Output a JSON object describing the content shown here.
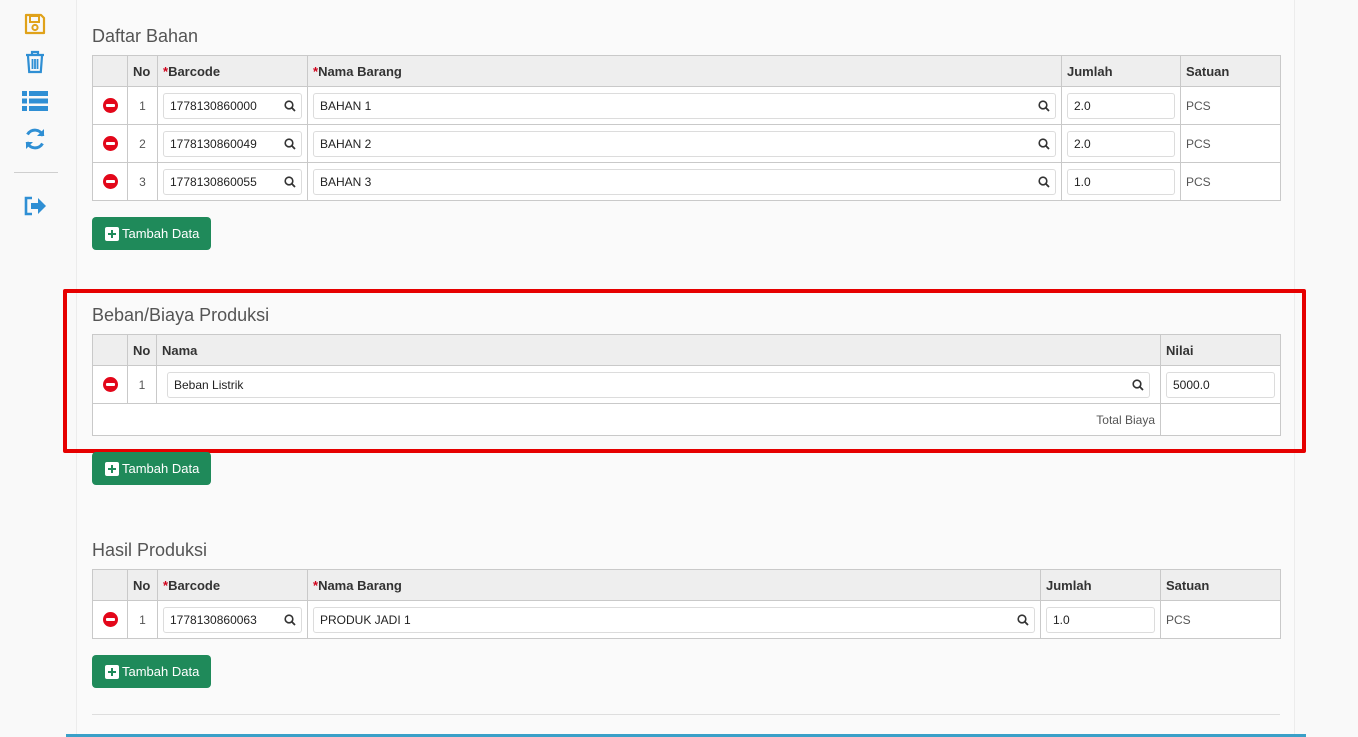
{
  "colors": {
    "accent_green": "#1f8a5a",
    "remove_red": "#e3071a",
    "highlight_red": "#e60000",
    "required_red": "#d0021b"
  },
  "sidebar": {
    "items": [
      {
        "name": "save-icon"
      },
      {
        "name": "trash-icon"
      },
      {
        "name": "list-icon"
      },
      {
        "name": "refresh-icon"
      },
      {
        "name": "logout-icon"
      }
    ]
  },
  "bahan": {
    "title": "Daftar Bahan",
    "headers": {
      "no": "No",
      "barcode_req": "*",
      "barcode": "Barcode",
      "nama_req": "*",
      "nama": "Nama Barang",
      "jumlah": "Jumlah",
      "satuan": "Satuan"
    },
    "rows": [
      {
        "no": "1",
        "barcode": "1778130860000",
        "nama": "BAHAN 1",
        "jumlah": "2.0",
        "satuan": "PCS"
      },
      {
        "no": "2",
        "barcode": "1778130860049",
        "nama": "BAHAN 2",
        "jumlah": "2.0",
        "satuan": "PCS"
      },
      {
        "no": "3",
        "barcode": "1778130860055",
        "nama": "BAHAN 3",
        "jumlah": "1.0",
        "satuan": "PCS"
      }
    ],
    "add_label": "Tambah Data"
  },
  "biaya": {
    "title": "Beban/Biaya Produksi",
    "headers": {
      "no": "No",
      "nama": "Nama",
      "nilai": "Nilai"
    },
    "rows": [
      {
        "no": "1",
        "nama": "Beban Listrik",
        "nilai": "5000.0"
      }
    ],
    "total_label": "Total Biaya",
    "add_label": "Tambah Data"
  },
  "hasil": {
    "title": "Hasil Produksi",
    "headers": {
      "no": "No",
      "barcode_req": "*",
      "barcode": "Barcode",
      "nama_req": "*",
      "nama": "Nama Barang",
      "jumlah": "Jumlah",
      "satuan": "Satuan"
    },
    "rows": [
      {
        "no": "1",
        "barcode": "1778130860063",
        "nama": "PRODUK JADI 1",
        "jumlah": "1.0",
        "satuan": "PCS"
      }
    ],
    "add_label": "Tambah Data"
  }
}
